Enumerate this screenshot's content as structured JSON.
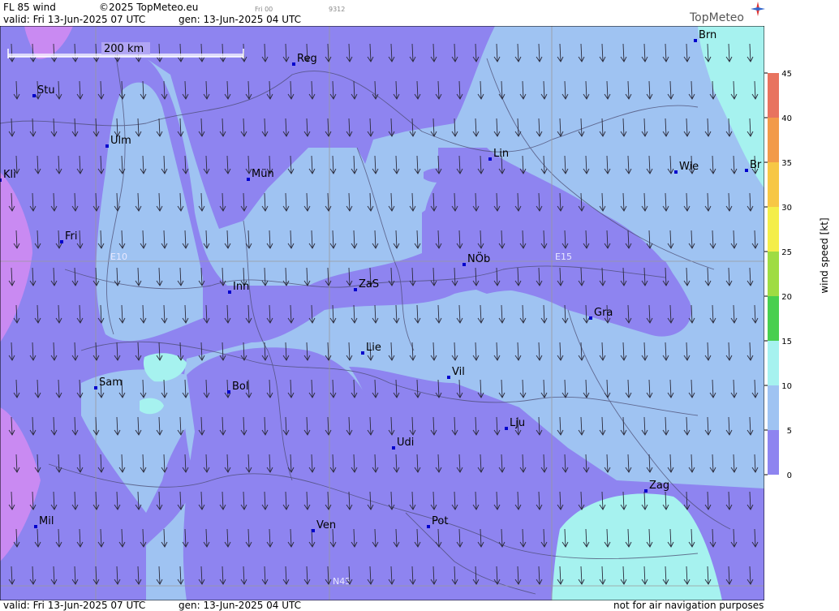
{
  "header": {
    "product": "FL 85 wind",
    "copyright": "©2025 TopMeteo.eu",
    "run_tag": "Fri 00",
    "code": "9312",
    "valid": "valid:  Fri  13-Jun-2025  07 UTC",
    "gen": "gen: 13-Jun-2025 04 UTC",
    "logo": "TopMeteo"
  },
  "footer": {
    "valid": "valid:  Fri  13-Jun-2025  07 UTC",
    "gen": "gen: 13-Jun-2025 04 UTC",
    "disclaimer": "not for air navigation purposes"
  },
  "map": {
    "scale_label": "200 km",
    "grid_labels": [
      "E10",
      "E15",
      "N45"
    ],
    "cities": [
      {
        "name": "Stu"
      },
      {
        "name": "Reg"
      },
      {
        "name": "Brn"
      },
      {
        "name": "Ulm"
      },
      {
        "name": "Mün"
      },
      {
        "name": "Lin"
      },
      {
        "name": "Wie"
      },
      {
        "name": "Br"
      },
      {
        "name": "Kli"
      },
      {
        "name": "Fri"
      },
      {
        "name": "NÖb"
      },
      {
        "name": "Inn"
      },
      {
        "name": "ZaS"
      },
      {
        "name": "Gra"
      },
      {
        "name": "Lie"
      },
      {
        "name": "Vil"
      },
      {
        "name": "Sam"
      },
      {
        "name": "Bol"
      },
      {
        "name": "Lju"
      },
      {
        "name": "Udi"
      },
      {
        "name": "Zag"
      },
      {
        "name": "Mil"
      },
      {
        "name": "Ven"
      },
      {
        "name": "Pot"
      }
    ],
    "wind_direction": "north to south"
  },
  "legend": {
    "title": "wind  speed  [kt]",
    "ticks": [
      "45",
      "40",
      "35",
      "30",
      "25",
      "20",
      "15",
      "10",
      "5",
      "0"
    ],
    "colors": [
      "#e8735f",
      "#f29a4a",
      "#f7c745",
      "#f4ee4a",
      "#9fdc43",
      "#49cf4f",
      "#a6f2ef",
      "#9fc3f2",
      "#8e84f0",
      "#c98af2"
    ]
  }
}
